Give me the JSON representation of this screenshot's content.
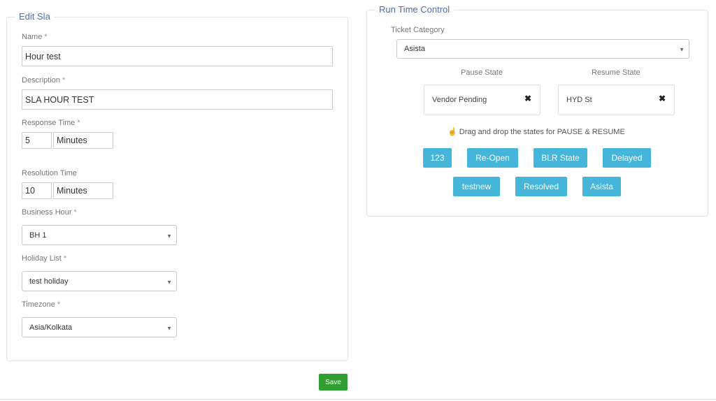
{
  "edit_sla": {
    "legend": "Edit Sla",
    "name_label": "Name",
    "name_value": "Hour test",
    "description_label": "Description",
    "description_value": "SLA HOUR TEST",
    "response_label": "Response Time",
    "response_value": "5",
    "response_unit": "Minutes",
    "resolution_label": "Resolution Time",
    "resolution_value": "10",
    "resolution_unit": "Minutes",
    "business_hour_label": "Business Hour",
    "business_hour_value": "BH 1",
    "holiday_label": "Holiday List",
    "holiday_value": "test holiday",
    "timezone_label": "Timezone",
    "timezone_value": "Asia/Kolkata",
    "required_mark": "*"
  },
  "run_time": {
    "legend": "Run Time Control",
    "category_label": "Ticket Category",
    "category_value": "Asista",
    "pause_label": "Pause State",
    "resume_label": "Resume State",
    "pause_value": "Vendor Pending",
    "resume_value": "HYD St",
    "hint": "Drag and drop the states for PAUSE & RESUME",
    "states": [
      "123",
      "Re-Open",
      "BLR State",
      "Delayed",
      "testnew",
      "Resolved",
      "Asista"
    ]
  },
  "icons": {
    "caret": "caret-down-icon",
    "remove": "close-icon",
    "hand": "hand-pointer-icon"
  },
  "colors": {
    "legend": "#4a6fb5",
    "chip": "#45b5da",
    "save": "#2fa02f"
  },
  "save_label": "Save"
}
